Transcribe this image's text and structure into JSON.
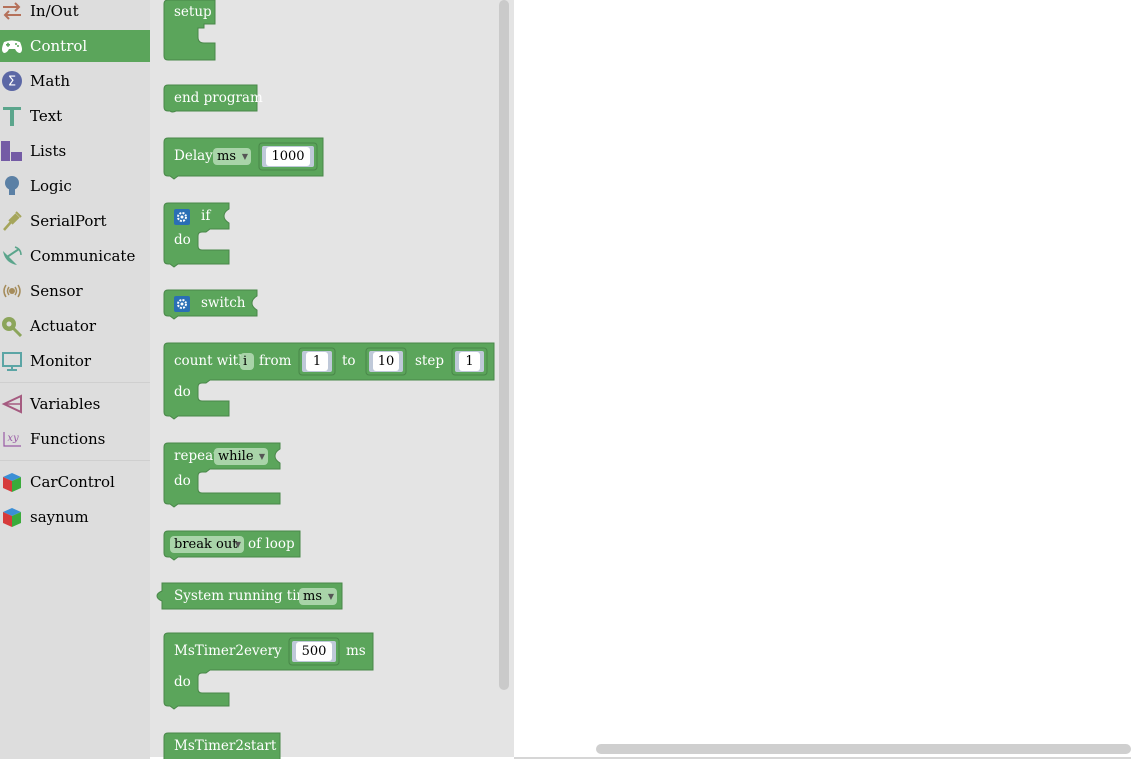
{
  "toolbox": {
    "categories": [
      {
        "label": "In/Out",
        "icon": "in-out-icon"
      },
      {
        "label": "Control",
        "icon": "gamepad-icon",
        "selected": true
      },
      {
        "label": "Math",
        "icon": "math-icon"
      },
      {
        "label": "Text",
        "icon": "text-icon"
      },
      {
        "label": "Lists",
        "icon": "lists-icon"
      },
      {
        "label": "Logic",
        "icon": "logic-icon"
      },
      {
        "label": "SerialPort",
        "icon": "serialport-icon"
      },
      {
        "label": "Communicate",
        "icon": "communicate-icon"
      },
      {
        "label": "Sensor",
        "icon": "sensor-icon"
      },
      {
        "label": "Actuator",
        "icon": "actuator-icon"
      },
      {
        "label": "Monitor",
        "icon": "monitor-icon"
      },
      {
        "label": "Variables",
        "icon": "variables-icon"
      },
      {
        "label": "Functions",
        "icon": "functions-icon"
      },
      {
        "label": "CarControl",
        "icon": "cube-icon"
      },
      {
        "label": "saynum",
        "icon": "cube-icon"
      }
    ]
  },
  "colors": {
    "block": "#5ba55b",
    "toolbox_bg": "#dddddd",
    "flyout_bg": "#e4e4e4",
    "selected": "#5ba55b"
  },
  "blocks": {
    "setup": {
      "label": "setup"
    },
    "end_program": {
      "label": "end program"
    },
    "delay": {
      "label": "Delay",
      "unit": "ms",
      "value": "1000"
    },
    "if_block": {
      "if": "if",
      "do": "do"
    },
    "switch_block": {
      "label": "switch"
    },
    "count_with": {
      "label": "count with",
      "var": "i",
      "from": "from",
      "from_val": "1",
      "to": "to",
      "to_val": "10",
      "step": "step",
      "step_val": "1",
      "do": "do"
    },
    "repeat": {
      "label": "repeat",
      "mode": "while",
      "do": "do"
    },
    "break_out": {
      "mode": "break out",
      "suffix": "of loop"
    },
    "system_time": {
      "label": "System running time",
      "unit": "ms"
    },
    "mstimer_every": {
      "label": "MsTimer2",
      "every": "every",
      "value": "500",
      "unit": "ms",
      "do": "do"
    },
    "mstimer_start": {
      "label": "MsTimer2",
      "start": "start"
    }
  }
}
